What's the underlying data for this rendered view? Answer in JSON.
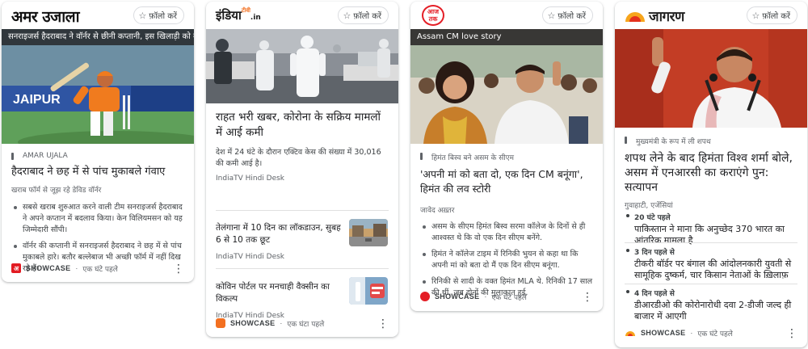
{
  "colors": {
    "follow_border": "#dadce0",
    "amarujala_red": "#e21b22",
    "indiatv_orange": "#f37021",
    "aajtak_red": "#e41e26",
    "jagran_orange": "#f7a51c"
  },
  "follow_label": "फ़ॉलो करें",
  "star_icon": "☆",
  "more_icon": "⋮",
  "showcase_label": "SHOWCASE",
  "cards": {
    "amarujala": {
      "publisher_logo": "अमर उजाला",
      "hero_caption": "सनराइजर्स हैदराबाद ने वॉर्नर से छीनी कप्तानी, इस खिलाड़ी को कमान",
      "hero_icon": "cricket-player-image",
      "section": "AMAR UJALA",
      "headline": "हैदराबाद ने छह में से पांच मुकाबले गंवाए",
      "source_meta": "खराब फॉर्म से जूझ रहे डेविड वॉर्नर",
      "bullets": [
        "सबसे खराब शुरुआत करने वाली टीम सनराइजर्स हैदराबाद ने अपने कप्तान में बदलाव किया। केन विलियमसन को यह जिम्मेदारी सौंपी।",
        "वॉर्नर की कप्तानी में सनराइजर्स हैदराबाद ने छह में से पांच मुकाबले हारे। बतौर बल्लेबाज भी अच्छी फॉर्म में नहीं दिख रहे हैं।"
      ],
      "footer_logo": "अ",
      "time": "एक घंटे पहले"
    },
    "indiatv": {
      "publisher_logo": "इंडिया",
      "publisher_logo_small": "टीवी",
      "publisher_logo_suffix": ".in",
      "hero_icon": "covid-hospital-image",
      "headline": "राहत भरी खबर, कोरोना के सक्रिय मामलों में आई कमी",
      "summary": "देश में 24 घंटे के दौरान एक्टिव केस की संख्या में 30,016 की कमी आई है।",
      "source": "IndiaTV Hindi Desk",
      "related": [
        {
          "title": "तेलंगाना में 10 दिन का लॉकडाउन, सुबह 6 से 10 तक छूट",
          "source": "IndiaTV Hindi Desk"
        },
        {
          "title": "कोविन पोर्टल पर मनचाही वैक्सीन का विकल्प",
          "source": "IndiaTV Hindi Desk"
        }
      ],
      "time": "एक घंटा पहले"
    },
    "aajtak": {
      "publisher_logo_top": "आज",
      "publisher_logo_bottom": "तक",
      "hero_caption": "Assam CM love story",
      "hero_icon": "couple-photo-image",
      "section": "हिमंत बिस्व बने असम के सीएम",
      "headline": "'अपनी मां को बता दो, एक दिन CM बनूंगा', हिमंत की लव स्टोरी",
      "author": "जावेद अख़्तर",
      "bullets": [
        "असम के सीएम हिमंत बिस्व सरमा कॉलेज के दिनों से ही आश्वस्त थे कि वो एक दिन सीएम बनेंगे.",
        "हिमंत ने कॉलेज टाइम में रिनिकी भुयन से कहा था कि अपनी मां को बता दो मैं एक दिन सीएम बनूंगा.",
        "रिनिकी से शादी के वक्त हिमंत MLA थे. रिनिकी 17 साल की थीं, जब दोनों की मुलाकात हुई."
      ],
      "time": "एक घंटे पहले"
    },
    "jagran": {
      "publisher_logo": "जागरण",
      "hero_icon": "politician-speech-image",
      "section": "मुख्यमंत्री के रूप में ली शपथ",
      "headline": "शपथ लेने के बाद हिमंता विश्व शर्मा बोले, असम में एनआरसी का कराएंगे पुन: सत्यापन",
      "dateline": "गुवाहाटी, एजेंसियां",
      "timeline": [
        {
          "time": "20 घंटे पहले",
          "text": "पाकिस्तान ने माना कि अनुच्छेद 370 भारत का आंतरिक मामला है"
        },
        {
          "time": "3 दिन पहले से",
          "text": "टीकरी बॉर्डर पर बंगाल की आंदोलनकारी युवती से सामूहिक दुष्कर्म, चार किसान नेताओं के ख़िलाफ़ केस दर्ज"
        },
        {
          "time": "4 दिन पहले से",
          "text": "डीआरडीओ की कोरोनारोधी दवा 2-डीजी जल्द ही बाजार में आएगी"
        }
      ],
      "time": "एक घंटे पहले"
    }
  }
}
